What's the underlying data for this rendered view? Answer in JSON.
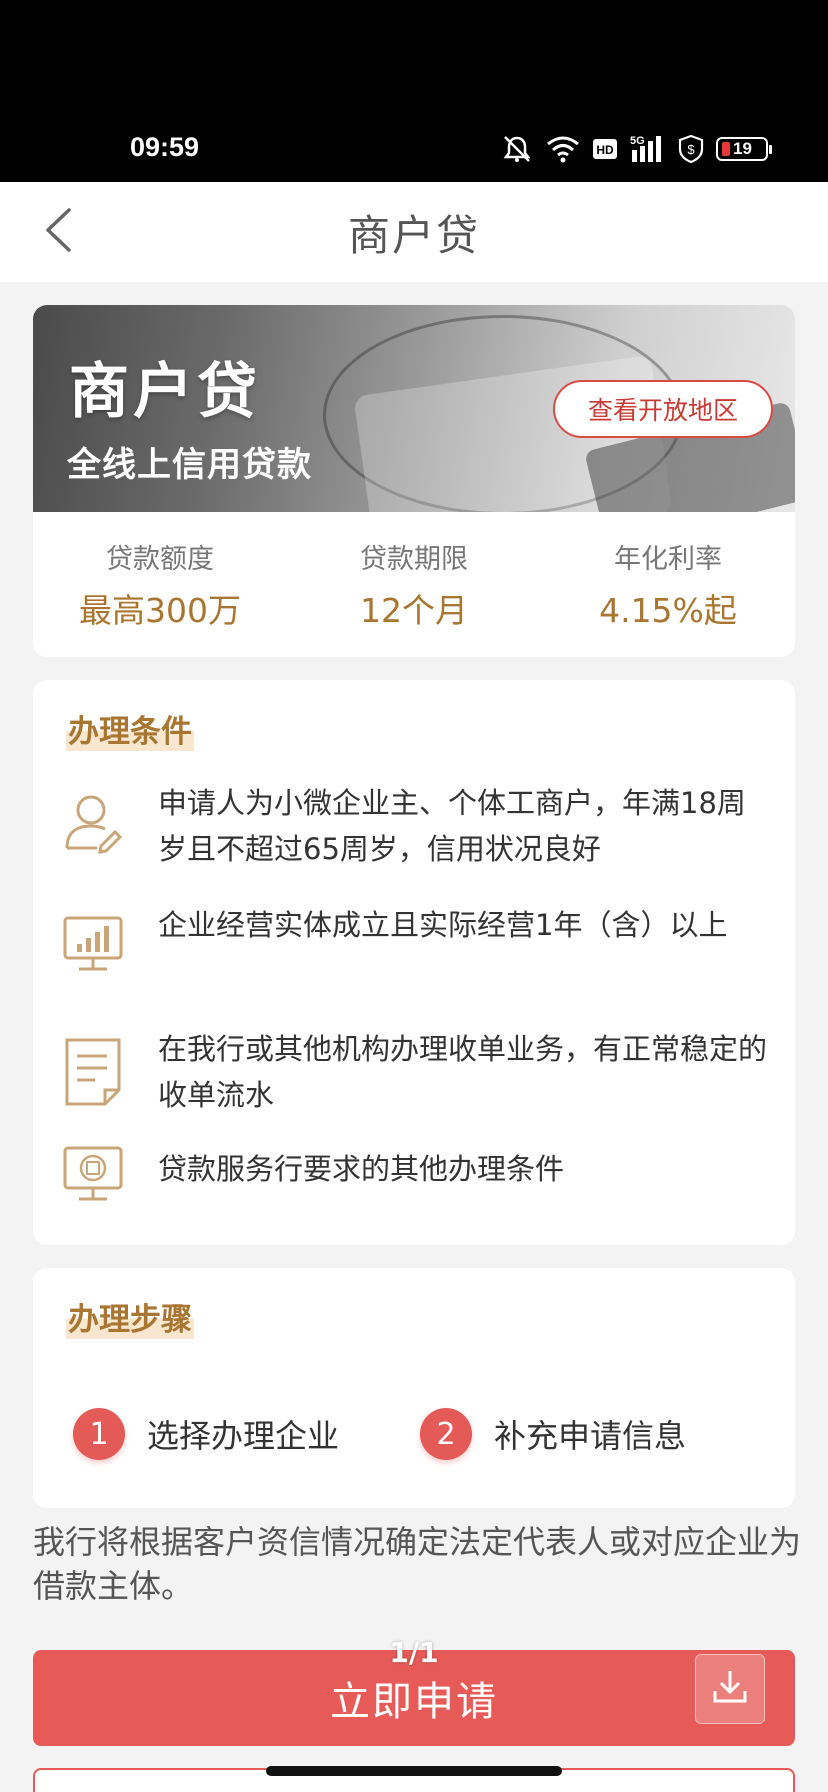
{
  "status_bar": {
    "time": "09:59",
    "network": "5G",
    "hd_label": "HD",
    "battery": "19",
    "icons": [
      "mute-icon",
      "wifi-icon",
      "hd-icon",
      "signal-icon",
      "shield-icon",
      "battery-icon"
    ]
  },
  "header": {
    "title": "商户贷",
    "back_icon": "chevron-left-icon"
  },
  "banner": {
    "title": "商户贷",
    "subtitle": "全线上信用贷款",
    "region_button": "查看开放地区"
  },
  "stats": [
    {
      "label": "贷款额度",
      "value": "最高300万"
    },
    {
      "label": "贷款期限",
      "value": "12个月"
    },
    {
      "label": "年化利率",
      "value": "4.15%起"
    }
  ],
  "conditions": {
    "title": "办理条件",
    "items": [
      {
        "icon": "user-edit-icon",
        "text": "申请人为小微企业主、个体工商户，年满18周岁且不超过65周岁，信用状况良好"
      },
      {
        "icon": "monitor-chart-icon",
        "text": "企业经营实体成立且实际经营1年（含）以上"
      },
      {
        "icon": "document-icon",
        "text": "在我行或其他机构办理收单业务，有正常稳定的收单流水"
      },
      {
        "icon": "bank-service-icon",
        "text": "贷款服务行要求的其他办理条件"
      }
    ]
  },
  "steps": {
    "title": "办理步骤",
    "items": [
      {
        "num": "1",
        "label": "选择办理企业"
      },
      {
        "num": "2",
        "label": "补充申请信息"
      }
    ]
  },
  "notice": "我行将根据客户资信情况确定法定代表人或对应企业为借款主体。",
  "page_indicator": "1/1",
  "apply_button": "立即申请",
  "download_icon": "download-icon",
  "colors": {
    "accent_gold": "#a87631",
    "primary_red": "#e65b57"
  }
}
